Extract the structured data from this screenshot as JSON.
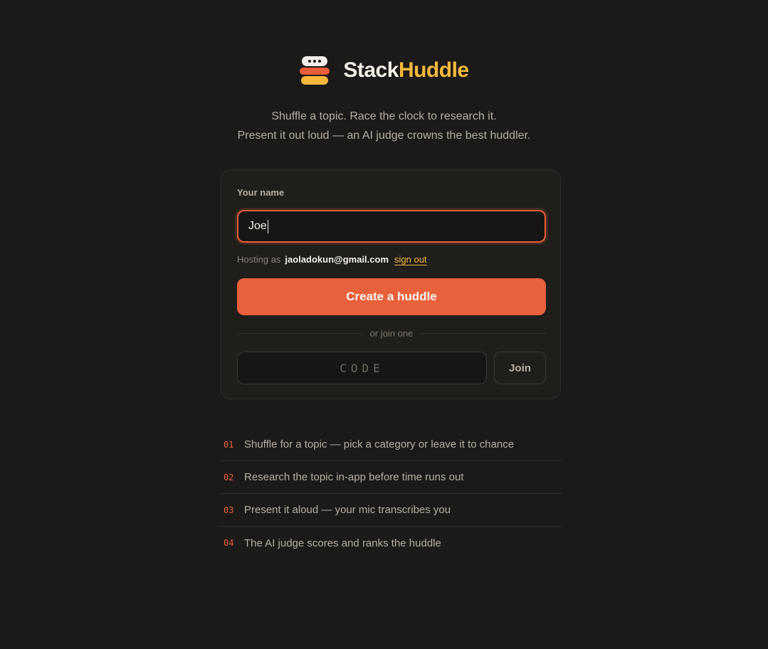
{
  "brand": {
    "logo_icon": "stacked-huddle-logo-icon",
    "name_part1": "Stack",
    "name_part2": "Huddle",
    "colors": {
      "primary": "#e8603c",
      "accent": "#f5b93e",
      "text": "#f3efe8",
      "background": "#1c1a18"
    }
  },
  "tagline": {
    "line1": "Shuffle a topic. Race the clock to research it.",
    "line2": "Present it out loud — an AI judge crowns the best huddler."
  },
  "form": {
    "name_label": "Your name",
    "name_value": "Joe",
    "hosting_prefix": "Hosting as",
    "hosting_email": "jaoladokun@gmail.com",
    "sign_out_label": "sign out",
    "create_button_label": "Create a huddle",
    "divider_text": "or join one",
    "code_placeholder": "CODE",
    "join_button_label": "Join"
  },
  "steps": [
    {
      "num": "01",
      "text": "Shuffle for a topic — pick a category or leave it to chance"
    },
    {
      "num": "02",
      "text": "Research the topic in-app before time runs out"
    },
    {
      "num": "03",
      "text": "Present it aloud — your mic transcribes you"
    },
    {
      "num": "04",
      "text": "The AI judge scores and ranks the huddle"
    }
  ]
}
